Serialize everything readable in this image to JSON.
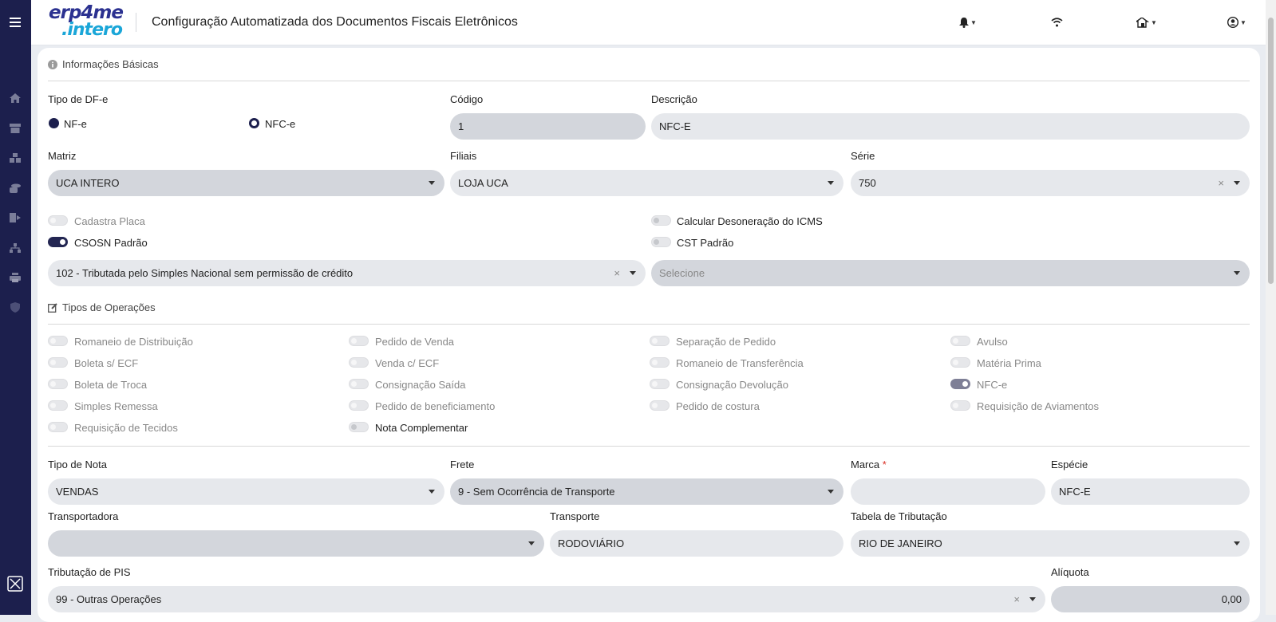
{
  "app": {
    "title": "Configuração Automatizada dos Documentos Fiscais Eletrônicos",
    "logo_line1": "erp4me",
    "logo_line2": ".intero"
  },
  "colors": {
    "sidebar": "#1c1f4d",
    "accent": "#232652",
    "field_bg": "#e6e8ec"
  },
  "sidebar": {
    "icons": [
      "menu-icon",
      "home-icon",
      "store-icon",
      "boxes-icon",
      "coins-icon",
      "export-icon",
      "network-icon",
      "printer-icon",
      "shield-icon",
      "close-panel-icon"
    ]
  },
  "topbar": {
    "icons": [
      "bell-icon",
      "wifi-icon",
      "home-building-icon",
      "user-avatar-icon"
    ]
  },
  "basic": {
    "section_title": "Informações Básicas",
    "tipo_df_label": "Tipo de DF-e",
    "radio_nfe": "NF-e",
    "radio_nfce": "NFC-e",
    "codigo_label": "Código",
    "codigo_value": "1",
    "descricao_label": "Descrição",
    "descricao_value": "NFC-E",
    "matriz_label": "Matriz",
    "matriz_value": "UCA INTERO",
    "filiais_label": "Filiais",
    "filiais_value": "LOJA UCA",
    "serie_label": "Série",
    "serie_value": "750",
    "cadastra_placa": "Cadastra Placa",
    "calcular_desoneracao": "Calcular Desoneração do ICMS",
    "csosn_padrao": "CSOSN Padrão",
    "cst_padrao": "CST Padrão",
    "csosn_value": "102 - Tributada pelo Simples Nacional sem permissão de crédito",
    "cst_placeholder": "Selecione"
  },
  "operacoes": {
    "section_title": "Tipos de Operações",
    "columns": [
      [
        "Romaneio de Distribuição",
        "Boleta s/ ECF",
        "Boleta de Troca",
        "Simples Remessa",
        "Requisição de Tecidos"
      ],
      [
        "Pedido de Venda",
        "Venda c/ ECF",
        "Consignação Saída",
        "Pedido de beneficiamento",
        "Nota Complementar"
      ],
      [
        "Separação de Pedido",
        "Romaneio de Transferência",
        "Consignação Devolução",
        "Pedido de costura"
      ],
      [
        "Avulso",
        "Matéria Prima",
        "NFC-e",
        "Requisição de Aviamentos"
      ]
    ]
  },
  "nota": {
    "tipo_nota_label": "Tipo de Nota",
    "tipo_nota_value": "VENDAS",
    "frete_label": "Frete",
    "frete_value": "9 - Sem Ocorrência de Transporte",
    "marca_label": "Marca",
    "marca_required": "*",
    "marca_value": "",
    "especie_label": "Espécie",
    "especie_value": "NFC-E",
    "transportadora_label": "Transportadora",
    "transportadora_value": "",
    "transporte_label": "Transporte",
    "transporte_value": "RODOVIÁRIO",
    "tabela_label": "Tabela de Tributação",
    "tabela_value": "RIO DE JANEIRO",
    "pis_label": "Tributação de PIS",
    "pis_value": "99 - Outras Operações",
    "aliquota_label": "Alíquota",
    "aliquota_value": "0,00"
  }
}
